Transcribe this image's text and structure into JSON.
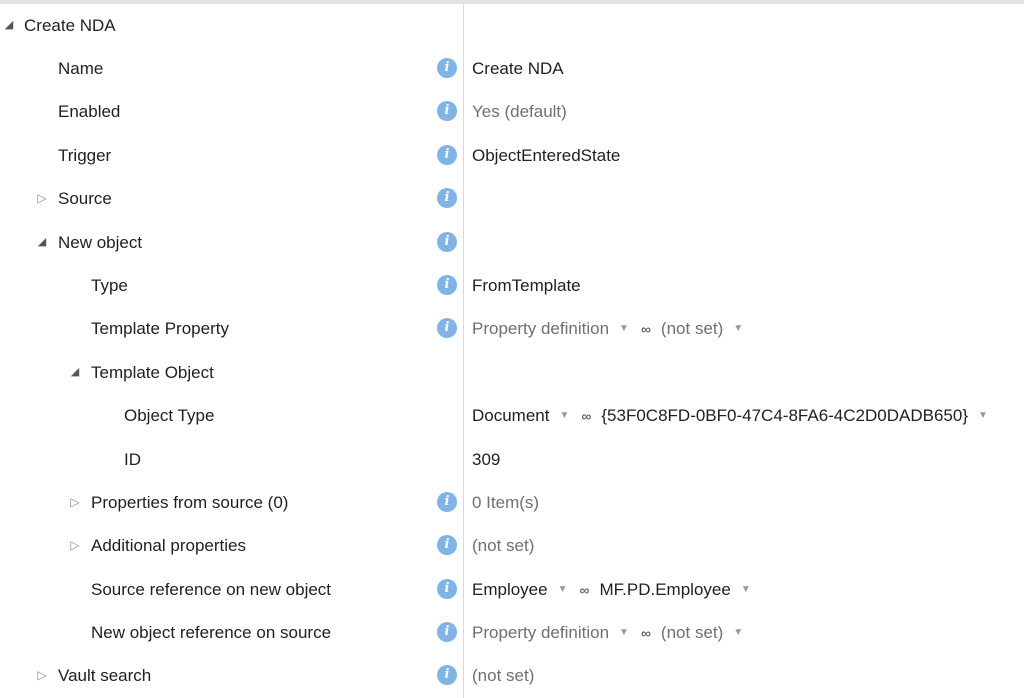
{
  "tree": {
    "root": {
      "label": "Create NDA"
    },
    "name": {
      "label": "Name",
      "value": "Create NDA"
    },
    "enabled": {
      "label": "Enabled",
      "value": "Yes (default)"
    },
    "trigger": {
      "label": "Trigger",
      "value": "ObjectEnteredState"
    },
    "source": {
      "label": "Source"
    },
    "new_object": {
      "label": "New object"
    },
    "type": {
      "label": "Type",
      "value": "FromTemplate"
    },
    "template_property": {
      "label": "Template Property",
      "value1": "Property definition",
      "value2": "(not set)"
    },
    "template_object": {
      "label": "Template Object"
    },
    "object_type": {
      "label": "Object Type",
      "value1": "Document",
      "value2": "{53F0C8FD-0BF0-47C4-8FA6-4C2D0DADB650}"
    },
    "id": {
      "label": "ID",
      "value": "309"
    },
    "properties_from_source": {
      "label": "Properties from source (0)",
      "value": "0 Item(s)"
    },
    "additional_properties": {
      "label": "Additional properties",
      "value": "(not set)"
    },
    "source_reference": {
      "label": "Source reference on new object",
      "value1": "Employee",
      "value2": "MF.PD.Employee"
    },
    "new_object_reference": {
      "label": "New object reference on source",
      "value1": "Property definition",
      "value2": "(not set)"
    },
    "vault_search": {
      "label": "Vault search",
      "value": "(not set)"
    }
  },
  "icons": {
    "expanded": "triangle-down-icon",
    "collapsed": "triangle-right-icon",
    "info": "info-icon",
    "link": "link-icon",
    "dropdown": "chevron-down-icon"
  },
  "colors": {
    "info": "#7fb5e6",
    "divider": "#d9d9d9"
  }
}
